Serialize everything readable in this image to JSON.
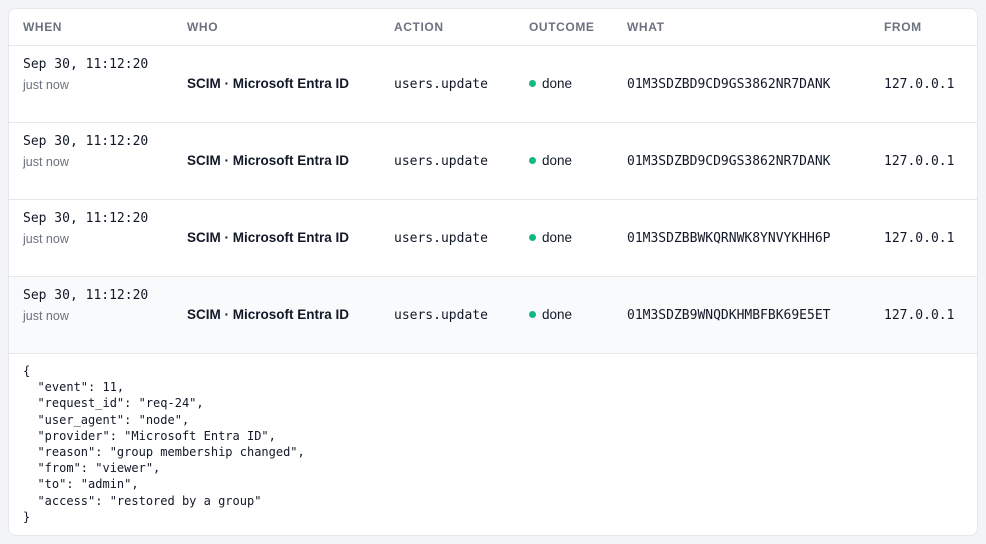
{
  "columns": {
    "when": "WHEN",
    "who": "WHO",
    "action": "ACTION",
    "outcome": "OUTCOME",
    "what": "WHAT",
    "from": "FROM"
  },
  "rows": [
    {
      "time": "Sep 30, 11:12:20",
      "relative": "just now",
      "who": "SCIM · Microsoft Entra ID",
      "action": "users.update",
      "outcome": "done",
      "what": "01M3SDZBD9CD9GS3862NR7DANK",
      "from": "127.0.0.1"
    },
    {
      "time": "Sep 30, 11:12:20",
      "relative": "just now",
      "who": "SCIM · Microsoft Entra ID",
      "action": "users.update",
      "outcome": "done",
      "what": "01M3SDZBD9CD9GS3862NR7DANK",
      "from": "127.0.0.1"
    },
    {
      "time": "Sep 30, 11:12:20",
      "relative": "just now",
      "who": "SCIM · Microsoft Entra ID",
      "action": "users.update",
      "outcome": "done",
      "what": "01M3SDZBBWKQRNWK8YNVYKHH6P",
      "from": "127.0.0.1"
    },
    {
      "time": "Sep 30, 11:12:20",
      "relative": "just now",
      "who": "SCIM · Microsoft Entra ID",
      "action": "users.update",
      "outcome": "done",
      "what": "01M3SDZB9WNQDKHMBFBK69E5ET",
      "from": "127.0.0.1"
    }
  ],
  "detail": {
    "json_text": "{\n  \"event\": 11,\n  \"request_id\": \"req-24\",\n  \"user_agent\": \"node\",\n  \"provider\": \"Microsoft Entra ID\",\n  \"reason\": \"group membership changed\",\n  \"from\": \"viewer\",\n  \"to\": \"admin\",\n  \"access\": \"restored by a group\"\n}"
  },
  "colors": {
    "done": "#10b981",
    "header_text": "#6b7280",
    "border": "#e5e7eb",
    "expanded_row_bg": "#f9fafb"
  }
}
